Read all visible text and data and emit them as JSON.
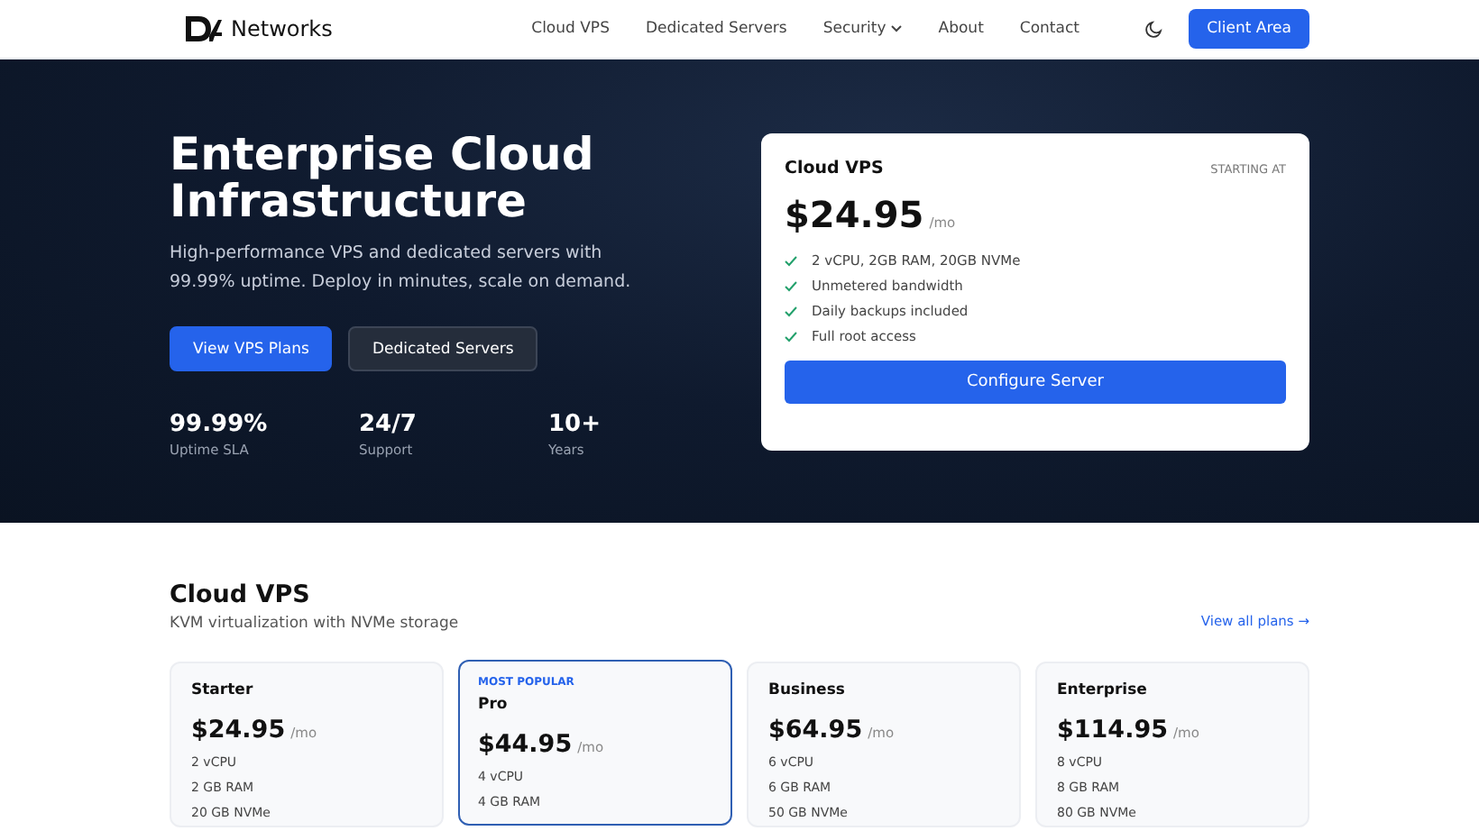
{
  "nav": {
    "brand": "Networks",
    "links": [
      {
        "label": "Cloud VPS",
        "dropdown": false
      },
      {
        "label": "Dedicated Servers",
        "dropdown": false
      },
      {
        "label": "Security",
        "dropdown": true
      },
      {
        "label": "About",
        "dropdown": false
      },
      {
        "label": "Contact",
        "dropdown": false
      }
    ],
    "cta": "Client Area"
  },
  "hero": {
    "title": "Enterprise Cloud Infrastructure",
    "subtitle": "High-performance VPS and dedicated servers with 99.99% uptime. Deploy in minutes, scale on demand.",
    "buttons": [
      {
        "label": "View VPS Plans",
        "kind": "primary"
      },
      {
        "label": "Dedicated Servers",
        "kind": "secondary"
      }
    ],
    "stats": [
      {
        "value": "99.99%",
        "label": "Uptime SLA"
      },
      {
        "value": "24/7",
        "label": "Support"
      },
      {
        "value": "10+",
        "label": "Years"
      }
    ],
    "card": {
      "title": "Cloud VPS",
      "note": "STARTING AT",
      "price": "$24.95",
      "period": "/mo",
      "features": [
        "2 vCPU, 2GB RAM, 20GB NVMe",
        "Unmetered bandwidth",
        "Daily backups included",
        "Full root access"
      ],
      "button": "Configure Server"
    }
  },
  "plans": {
    "title": "Cloud VPS",
    "subtitle": "KVM virtualization with NVMe storage",
    "link": "View all plans →",
    "items": [
      {
        "name": "Starter",
        "featured": false,
        "price": "$24.95",
        "period": "/mo",
        "specs": [
          "2 vCPU",
          "2 GB RAM",
          "20 GB NVMe"
        ]
      },
      {
        "name": "Pro",
        "featured": true,
        "badge": "MOST POPULAR",
        "price": "$44.95",
        "period": "/mo",
        "specs": [
          "4 vCPU",
          "4 GB RAM"
        ]
      },
      {
        "name": "Business",
        "featured": false,
        "price": "$64.95",
        "period": "/mo",
        "specs": [
          "6 vCPU",
          "6 GB RAM",
          "50 GB NVMe"
        ]
      },
      {
        "name": "Enterprise",
        "featured": false,
        "price": "$114.95",
        "period": "/mo",
        "specs": [
          "8 vCPU",
          "8 GB RAM",
          "80 GB NVMe"
        ]
      }
    ]
  }
}
